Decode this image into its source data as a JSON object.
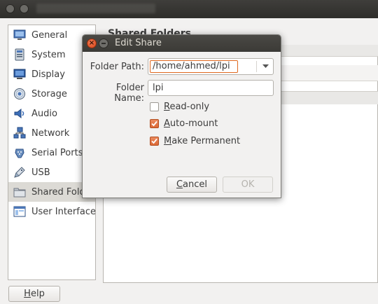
{
  "sidebar": {
    "items": [
      {
        "label": "General",
        "icon": "general-icon"
      },
      {
        "label": "System",
        "icon": "system-icon"
      },
      {
        "label": "Display",
        "icon": "display-icon"
      },
      {
        "label": "Storage",
        "icon": "storage-icon"
      },
      {
        "label": "Audio",
        "icon": "audio-icon"
      },
      {
        "label": "Network",
        "icon": "network-icon"
      },
      {
        "label": "Serial Ports",
        "icon": "serial-ports-icon"
      },
      {
        "label": "USB",
        "icon": "usb-icon"
      },
      {
        "label": "Shared Folders",
        "icon": "shared-folders-icon",
        "selected": true
      },
      {
        "label": "User Interface",
        "icon": "user-interface-icon"
      }
    ]
  },
  "panel": {
    "title": "Shared Folders"
  },
  "footer": {
    "help_label": "Help"
  },
  "dialog": {
    "title": "Edit Share",
    "folder_path_label": "Folder Path:",
    "folder_path_value": "/home/ahmed/lpi",
    "folder_name_label": "Folder Name:",
    "folder_name_value": "lpi",
    "read_only_label": "Read-only",
    "read_only_checked": false,
    "auto_mount_label": "Auto-mount",
    "auto_mount_checked": true,
    "make_permanent_label": "Make Permanent",
    "make_permanent_checked": true,
    "cancel_label": "Cancel",
    "ok_label": "OK"
  },
  "colors": {
    "accent": "#dd6a36",
    "titlebar": "#3b3a36",
    "close": "#e0582a"
  }
}
